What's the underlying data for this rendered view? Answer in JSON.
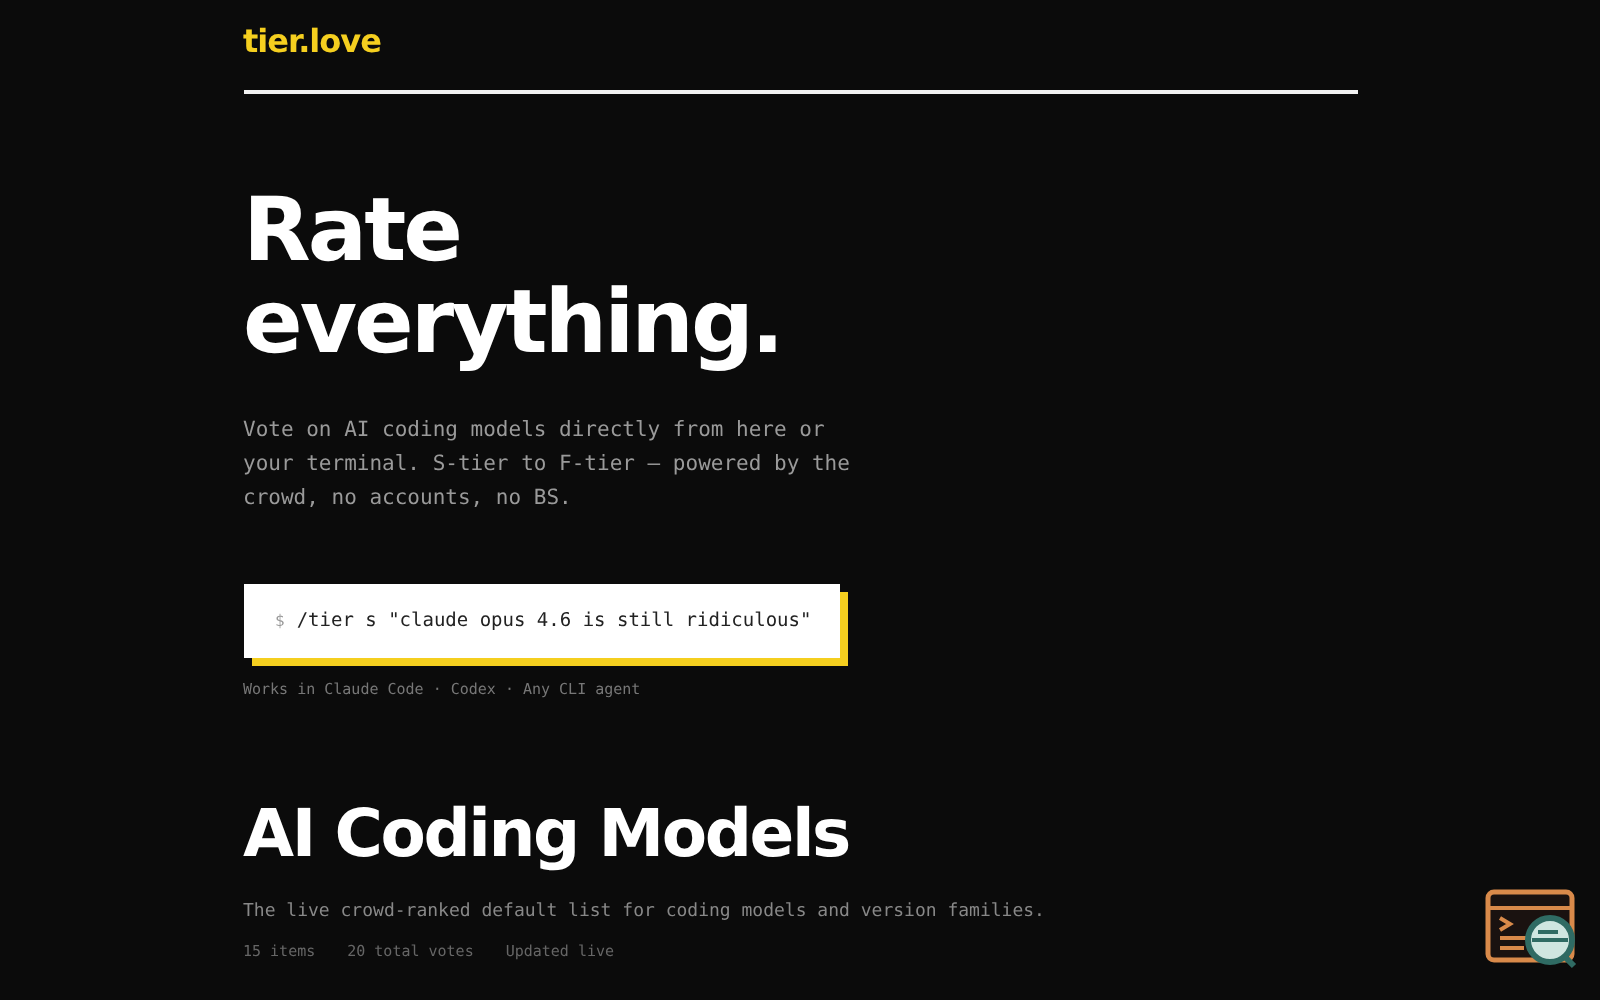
{
  "logo": "tier.love",
  "hero": {
    "title_lines": [
      "Rate",
      "everything."
    ],
    "description": "Vote on AI coding models directly from here or your terminal. S-tier to F-tier — powered by the crowd, no accounts, no BS.",
    "command": {
      "prompt": "$",
      "text": "/tier s \"claude opus 4.6 is still ridiculous\""
    },
    "works_in": "Works in Claude Code · Codex · Any CLI agent"
  },
  "section": {
    "title": "AI Coding Models",
    "description": "The live crowd-ranked default list for coding models and version families.",
    "meta": [
      "15 items",
      "20 total votes",
      "Updated live"
    ]
  }
}
